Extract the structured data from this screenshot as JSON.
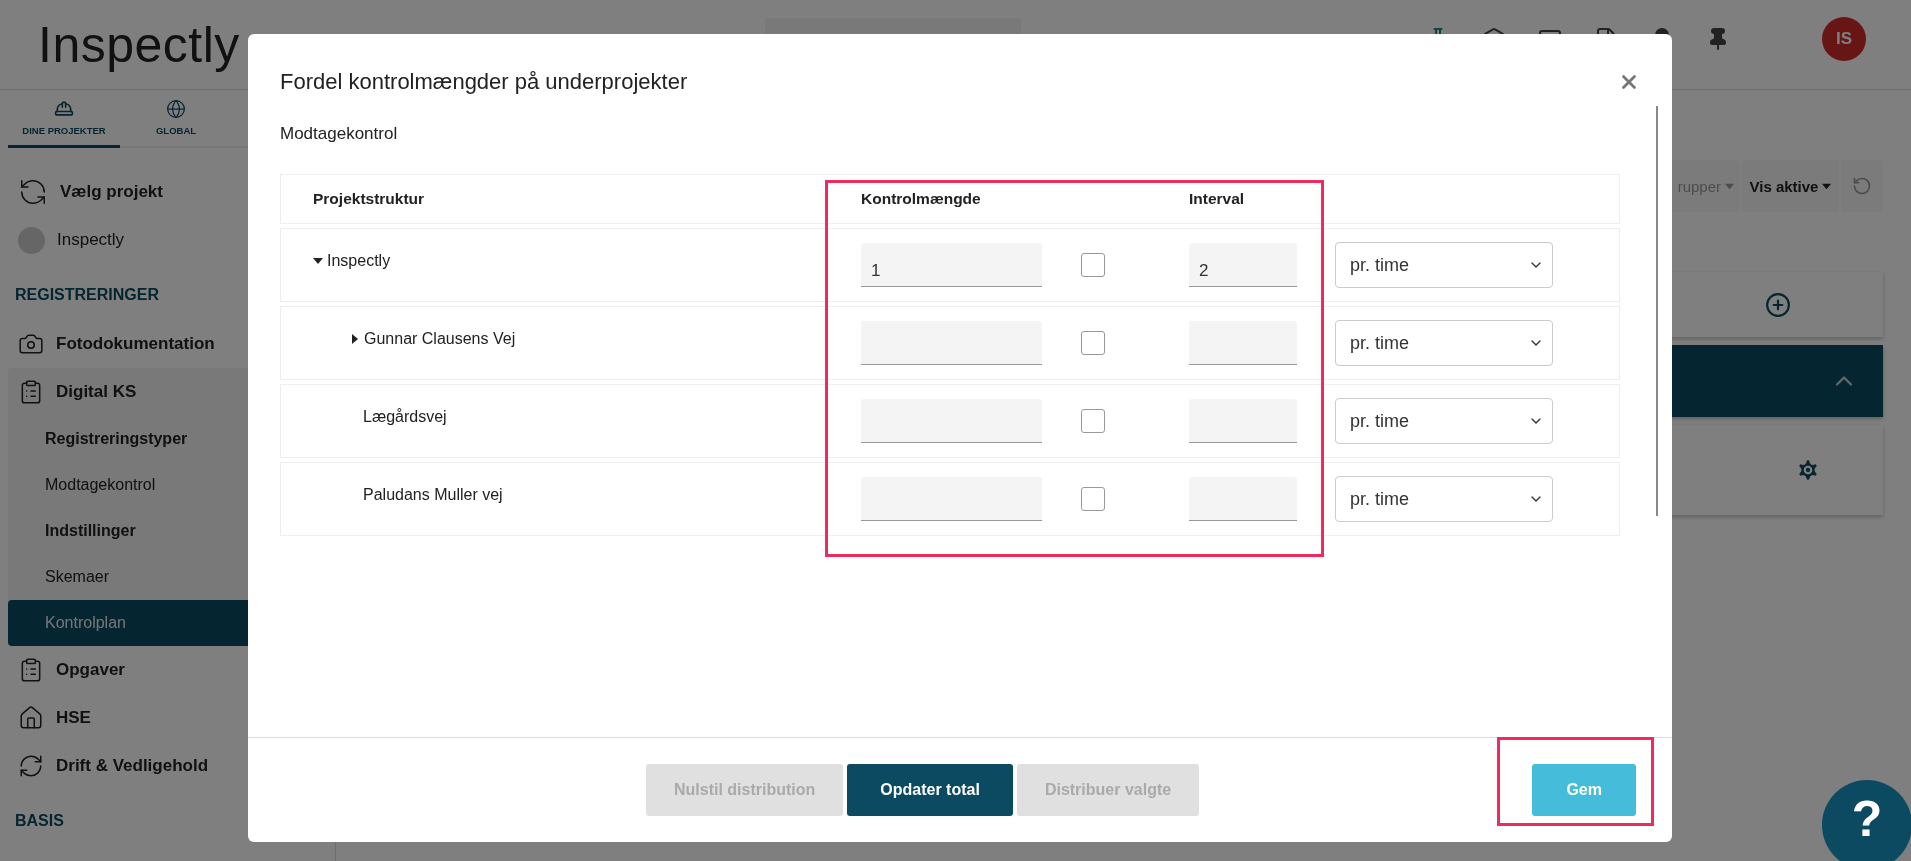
{
  "header": {
    "logo": "Inspectly",
    "avatar": "IS"
  },
  "nav_tabs": [
    {
      "label": "DINE PROJEKTER",
      "selected": true
    },
    {
      "label": "GLOBAL",
      "selected": false
    }
  ],
  "sidebar": [
    {
      "kind": "picker",
      "label": "Vælg projekt"
    },
    {
      "kind": "project",
      "label": "Inspectly"
    },
    {
      "kind": "section",
      "label": "REGISTRERINGER"
    },
    {
      "kind": "item",
      "label": "Fotodokumentation"
    },
    {
      "kind": "item",
      "label": "Digital KS",
      "children": [
        {
          "kind": "heading",
          "label": "Registreringstyper"
        },
        {
          "kind": "link",
          "label": "Modtagekontrol",
          "selected": false
        },
        {
          "kind": "heading",
          "label": "Indstillinger"
        },
        {
          "kind": "link",
          "label": "Skemaer",
          "selected": false
        },
        {
          "kind": "link",
          "label": "Kontrolplan",
          "selected": true
        }
      ]
    },
    {
      "kind": "item",
      "label": "Opgaver"
    },
    {
      "kind": "item",
      "label": "HSE"
    },
    {
      "kind": "item",
      "label": "Drift & Vedligehold"
    },
    {
      "kind": "section",
      "label": "BASIS"
    }
  ],
  "toolbar": [
    {
      "label": "rupper",
      "active": false
    },
    {
      "label": "Vis aktive",
      "active": true
    }
  ],
  "dialog": {
    "title": "Fordel kontrolmængder på underprojekter",
    "subtitle": "Modtagekontrol",
    "columns": [
      "Projektstruktur",
      "Kontrolmængde",
      "Interval"
    ],
    "rows": [
      {
        "name": "Inspectly",
        "expanded": true,
        "amount": "1",
        "checked": false,
        "interval": "2",
        "unit": "pr. time",
        "children": [
          {
            "name": "Gunnar Clausens Vej",
            "expanded": false,
            "checked": false,
            "unit": "pr. time"
          },
          {
            "name": "Lægårdsvej",
            "checked": false,
            "unit": "pr. time"
          },
          {
            "name": "Paludans Muller vej",
            "checked": false,
            "unit": "pr. time"
          }
        ]
      }
    ],
    "actions": [
      {
        "label": "Nulstil distribution",
        "disabled": true
      },
      {
        "label": "Opdater total",
        "disabled": false
      },
      {
        "label": "Distribuer valgte",
        "disabled": true
      }
    ],
    "save": {
      "label": "Gem"
    }
  },
  "help": {
    "label": "?"
  }
}
